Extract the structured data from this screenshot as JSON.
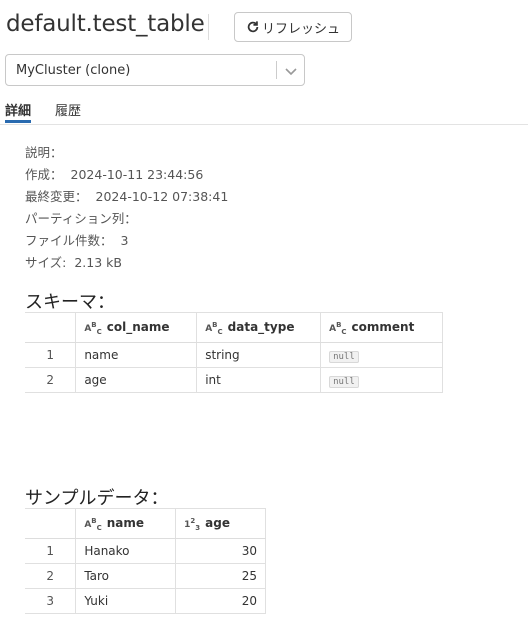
{
  "header": {
    "title": "default.test_table",
    "refresh_label": "リフレッシュ"
  },
  "cluster_select": {
    "value": "MyCluster (clone)"
  },
  "tabs": [
    {
      "label": "詳細",
      "active": true
    },
    {
      "label": "履歴",
      "active": false
    }
  ],
  "details": {
    "description": {
      "label": "説明：",
      "value": ""
    },
    "created": {
      "label": "作成：",
      "value": "2024-10-11 23:44:56"
    },
    "modified": {
      "label": "最終変更：",
      "value": "2024-10-12 07:38:41"
    },
    "partition": {
      "label": "パーティション列：",
      "value": ""
    },
    "file_count": {
      "label": "ファイル件数：",
      "value": "3"
    },
    "size": {
      "label": "サイズ:",
      "value": "2.13 kB"
    }
  },
  "schema": {
    "title": "スキーマ：",
    "columns": [
      "col_name",
      "data_type",
      "comment"
    ],
    "rows": [
      {
        "index": "1",
        "col_name": "name",
        "data_type": "string",
        "comment": "null"
      },
      {
        "index": "2",
        "col_name": "age",
        "data_type": "int",
        "comment": "null"
      }
    ]
  },
  "sample": {
    "title": "サンプルデータ：",
    "columns": [
      "name",
      "age"
    ],
    "rows": [
      {
        "index": "1",
        "name": "Hanako",
        "age": "30"
      },
      {
        "index": "2",
        "name": "Taro",
        "age": "25"
      },
      {
        "index": "3",
        "name": "Yuki",
        "age": "20"
      }
    ]
  }
}
